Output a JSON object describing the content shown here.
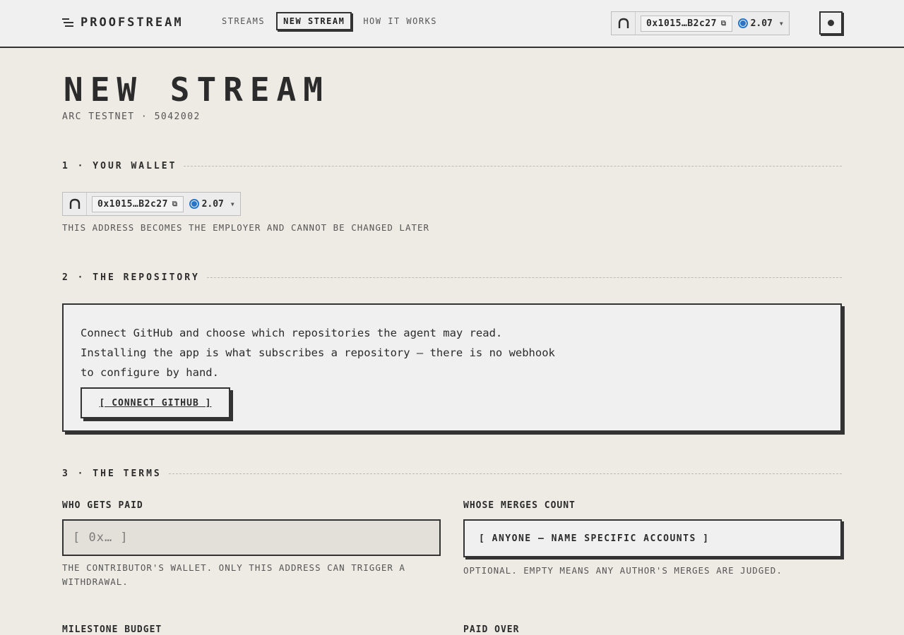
{
  "header": {
    "brand": "PROOFSTREAM",
    "nav": [
      {
        "label": "STREAMS"
      },
      {
        "label": "NEW STREAM",
        "active": true
      },
      {
        "label": "HOW IT WORKS"
      }
    ],
    "wallet": {
      "address": "0x1015…B2c27",
      "balance": "2.07"
    }
  },
  "page": {
    "title": "NEW STREAM",
    "subtitle": "ARC TESTNET · 5042002"
  },
  "sections": {
    "wallet": {
      "heading": "1 · YOUR WALLET",
      "address": "0x1015…B2c27",
      "balance": "2.07",
      "hint": "THIS ADDRESS BECOMES THE EMPLOYER AND CANNOT BE CHANGED LATER"
    },
    "repo": {
      "heading": "2 · THE REPOSITORY",
      "line1": "Connect GitHub and choose which repositories the agent may read.",
      "line2": "Installing the app is what subscribes a repository — there is no webhook",
      "line3": "to configure by hand.",
      "button": "[ CONNECT GITHUB ]"
    },
    "terms": {
      "heading": "3 · THE TERMS",
      "who_label": "WHO GETS PAID",
      "who_placeholder": "[ 0x… ]",
      "who_hint_1": "THE CONTRIBUTOR'S WALLET. ONLY THIS ADDRESS CAN TRIGGER A",
      "who_hint_2": "WITHDRAWAL.",
      "merges_label": "WHOSE MERGES COUNT",
      "merges_value": "[ ANYONE — NAME SPECIFIC ACCOUNTS ]",
      "merges_hint": "OPTIONAL. EMPTY MEANS ANY AUTHOR'S MERGES ARE JUDGED.",
      "budget_label": "MILESTONE BUDGET",
      "paid_over_label": "PAID OVER"
    }
  },
  "colors": {
    "ink": "#2b2b2b",
    "paper": "#edebe4",
    "panel": "#f0f0f0",
    "usdc": "#2775ca"
  }
}
